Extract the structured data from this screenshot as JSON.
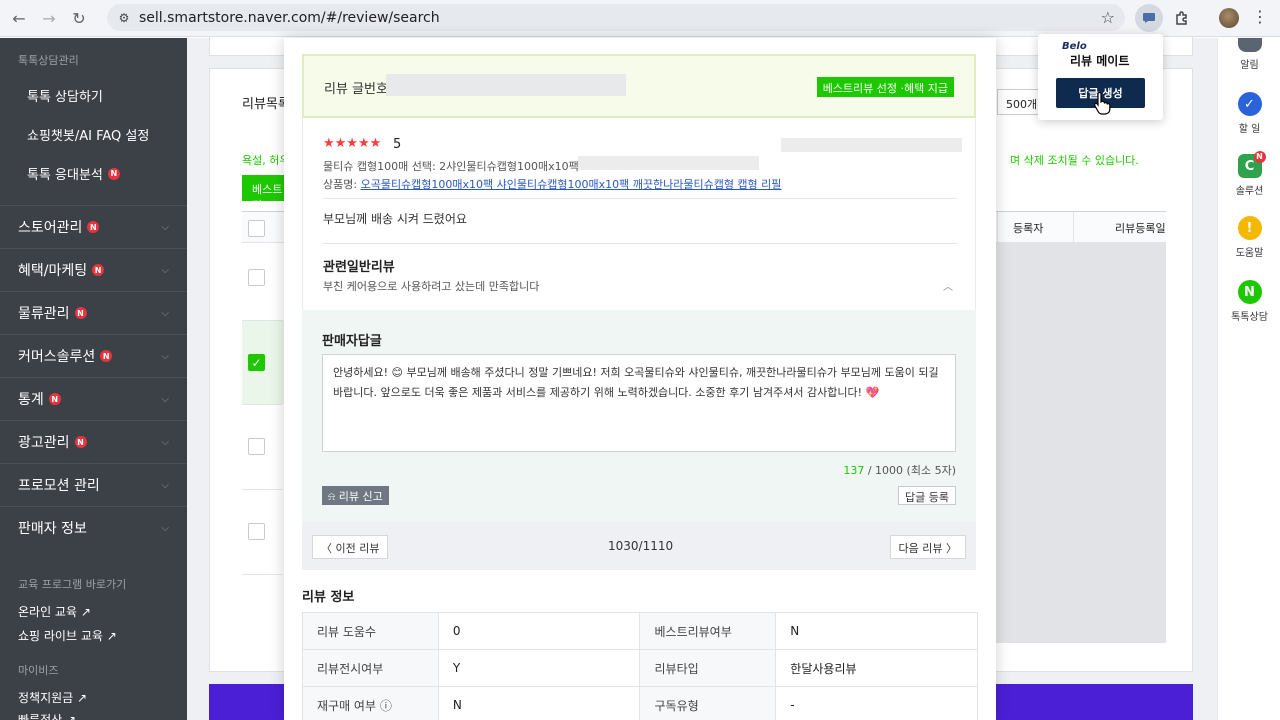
{
  "browser": {
    "url": "sell.smartstore.naver.com/#/review/search"
  },
  "sidebar": {
    "section_label": "톡톡상담관리",
    "sub_items": [
      {
        "label": "톡톡 상담하기"
      },
      {
        "label": "쇼핑챗봇/AI FAQ 설정"
      },
      {
        "label": "톡톡 응대분석",
        "badge": "N"
      }
    ],
    "main_items": [
      {
        "label": "스토어관리",
        "badge": "N"
      },
      {
        "label": "혜택/마케팅",
        "badge": "N"
      },
      {
        "label": "물류관리",
        "badge": "N"
      },
      {
        "label": "커머스솔루션",
        "badge": "N"
      },
      {
        "label": "통계",
        "badge": "N"
      },
      {
        "label": "광고관리",
        "badge": "N"
      },
      {
        "label": "프로모션 관리"
      },
      {
        "label": "판매자 정보"
      }
    ],
    "edu_label": "교육 프로그램 바로가기",
    "edu_links": [
      "온라인 교육 ↗",
      "쇼핑 라이브 교육 ↗"
    ],
    "mybiz_label": "마이비즈",
    "mybiz_links": [
      "정책지원금 ↗",
      "빠른정산 ↗"
    ]
  },
  "background": {
    "list_title": "리뷰목록",
    "warning_left": "욕설, 허우",
    "warning_right": "며 삭제 조치될 수 있습니다.",
    "green_button": "베스트리",
    "page_size": "500개",
    "col_registrant": "등록자",
    "col_review_date": "리뷰등록일"
  },
  "modal": {
    "review_no_label": "리뷰 글번호 :",
    "best_review_button": "베스트리뷰 선정 ·혜택 지급",
    "stars": "★★★★★",
    "score": "5",
    "option_text": "물티슈 캡형100매 선택: 2샤인물티슈캡형100매x10팩",
    "product_label": "상품명:",
    "product_name": "오곡물티슈캡형100매x10팩 샤인물티슈캡형100매x10팩 깨끗한나라물티슈캡형 캡형 리필",
    "review_body": "부모님께 배송 시켜 드렸어요",
    "related_title": "관련일반리뷰",
    "related_body": "부친 케어용으로 사용하려고 샀는데 만족합니다",
    "reply_title": "판매자답글",
    "reply_text": "안녕하세요! 😊 부모님께 배송해 주셨다니 정말 기쁘네요! 저희 오곡물티슈와 샤인물티슈, 깨끗한나라물티슈가 부모님께 도움이 되길 바랍니다. 앞으로도 더욱 좋은 제품과 서비스를 제공하기 위해 노력하겠습니다. 소중한 후기 남겨주셔서 감사합니다! 💖",
    "char_count": "137",
    "char_limit": " / 1000 (최소 5자)",
    "report_button": "리뷰 신고",
    "submit_button": "답글 등록",
    "prev_button": "〈 이전 리뷰",
    "counter": "1030/1110",
    "next_button": "다음 리뷰 〉",
    "info_title": "리뷰 정보",
    "info_rows": [
      {
        "l1": "리뷰 도움수",
        "v1": "0",
        "l2": "베스트리뷰여부",
        "v2": "N"
      },
      {
        "l1": "리뷰전시여부",
        "v1": "Y",
        "l2": "리뷰타입",
        "v2": "한달사용리뷰"
      },
      {
        "l1": "재구매 여부 ⓘ",
        "v1": "N",
        "l2": "구독유형",
        "v2": "-"
      }
    ]
  },
  "extension_popup": {
    "brand": "Belo",
    "title": "리뷰 메이트",
    "button": "답글 생성"
  },
  "right_rail": [
    {
      "label": "알림",
      "icon": "bell-icon"
    },
    {
      "label": "할 일",
      "icon": "check-icon"
    },
    {
      "label": "솔루션",
      "icon": "solution-icon",
      "badge": "N"
    },
    {
      "label": "도움말",
      "icon": "help-icon"
    },
    {
      "label": "톡톡상담",
      "icon": "talktalk-icon"
    }
  ],
  "colors": {
    "naver_green": "#1ec800",
    "sidebar_bg": "#3c4047",
    "badge_red": "#e8343d",
    "popup_button": "#0f2a4f",
    "banner_purple": "#4b1fd6"
  }
}
